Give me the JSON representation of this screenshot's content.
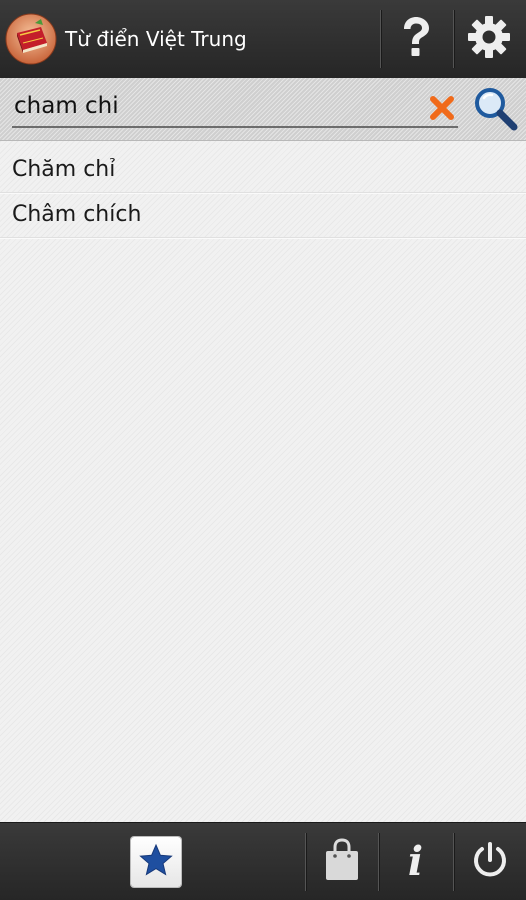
{
  "app": {
    "title": "Từ điển Việt Trung",
    "icon": "dictionary-book-icon"
  },
  "toolbar": {
    "help_icon": "question-mark-icon",
    "settings_icon": "gear-icon"
  },
  "search": {
    "value": "cham chi",
    "placeholder": "",
    "clear_icon": "close-icon",
    "search_icon": "magnifier-icon",
    "accent_color": "#f06a1a"
  },
  "results": [
    {
      "label": "Chăm chỉ"
    },
    {
      "label": "Châm chích"
    }
  ],
  "bottom_bar": {
    "favorites_icon": "star-icon",
    "store_icon": "shopping-bag-icon",
    "info_icon": "info-icon",
    "info_glyph": "i",
    "power_icon": "power-icon",
    "star_color": "#1f4fa0"
  }
}
